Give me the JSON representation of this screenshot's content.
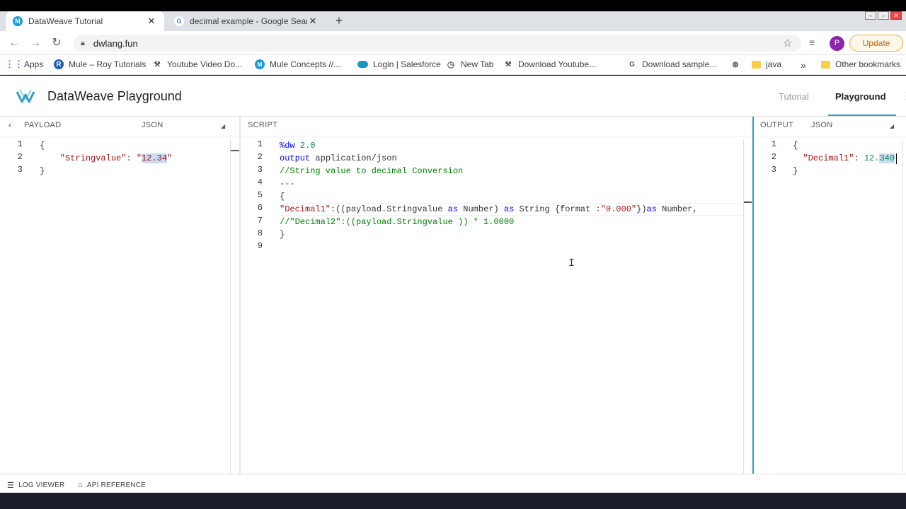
{
  "browser": {
    "tabs": [
      {
        "title": "DataWeave Tutorial",
        "icon": "mulesoft-icon",
        "active": true
      },
      {
        "title": "decimal example - Google Search",
        "icon": "google-icon",
        "active": false
      }
    ],
    "url": "dwlang.fun",
    "update_label": "Update",
    "profile_initial": "P",
    "bookmarks": [
      {
        "label": "Apps",
        "icon": "apps-grid-icon"
      },
      {
        "label": "Mule – Roy Tutorials",
        "icon": "roy-icon"
      },
      {
        "label": "Youtube Video Do...",
        "icon": "hammer-icon"
      },
      {
        "label": "Mule Concepts //...",
        "icon": "mulesoft-icon"
      },
      {
        "label": "Login | Salesforce",
        "icon": "salesforce-cloud-icon"
      },
      {
        "label": "New Tab",
        "icon": "history-icon"
      },
      {
        "label": "Download Youtube...",
        "icon": "hammer-icon"
      },
      {
        "label": "Download sample...",
        "icon": "google-icon"
      },
      {
        "label": "java",
        "icon": "folder-icon"
      },
      {
        "label": "Other bookmarks",
        "icon": "folder-icon"
      }
    ],
    "overflow": "»"
  },
  "app": {
    "title": "DataWeave Playground",
    "nav": {
      "tutorial": "Tutorial",
      "playground": "Playground"
    }
  },
  "payload": {
    "header": "PAYLOAD",
    "format": "JSON",
    "lines": [
      "1",
      "2",
      "3"
    ]
  },
  "script": {
    "header": "SCRIPT",
    "lines": [
      "1",
      "2",
      "3",
      "4",
      "5",
      "6",
      "7",
      "8",
      "9"
    ]
  },
  "output": {
    "header": "OUTPUT",
    "format": "JSON",
    "lines": [
      "1",
      "2",
      "3"
    ]
  },
  "footer": {
    "log_viewer": "LOG VIEWER",
    "api_reference": "API REFERENCE"
  },
  "colors": {
    "accent": "#2aa0c8",
    "string": "#a31515",
    "keyword": "#0000ff",
    "comment": "#008000",
    "number": "#098658"
  }
}
